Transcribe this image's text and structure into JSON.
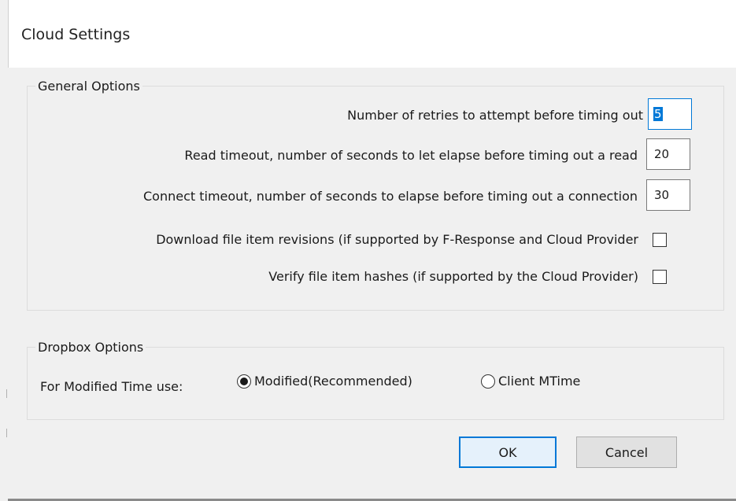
{
  "window": {
    "title": "Cloud Settings"
  },
  "general_options": {
    "group_label": "General Options",
    "retries": {
      "label": "Number of retries to attempt before timing out",
      "value": "5"
    },
    "read_timeout": {
      "label": "Read timeout, number of seconds to let elapse before timing out a read",
      "value": "20"
    },
    "connect_timeout": {
      "label": "Connect timeout, number of seconds to elapse before timing out a connection",
      "value": "30"
    },
    "download_revisions": {
      "label": "Download file item revisions (if supported by F-Response and Cloud Provider",
      "checked": false
    },
    "verify_hashes": {
      "label": "Verify file item hashes (if supported by the Cloud Provider)",
      "checked": false
    }
  },
  "dropbox_options": {
    "group_label": "Dropbox Options",
    "modified_time_label": "For Modified Time use:",
    "radio_options": [
      {
        "label": "Modified(Recommended)",
        "selected": true
      },
      {
        "label": "Client MTime",
        "selected": false
      }
    ]
  },
  "buttons": {
    "ok_label": "OK",
    "cancel_label": "Cancel"
  },
  "colors": {
    "accent": "#0078d7",
    "dialog_bg": "#f0f0f0",
    "button_bg": "#e1e1e1"
  }
}
